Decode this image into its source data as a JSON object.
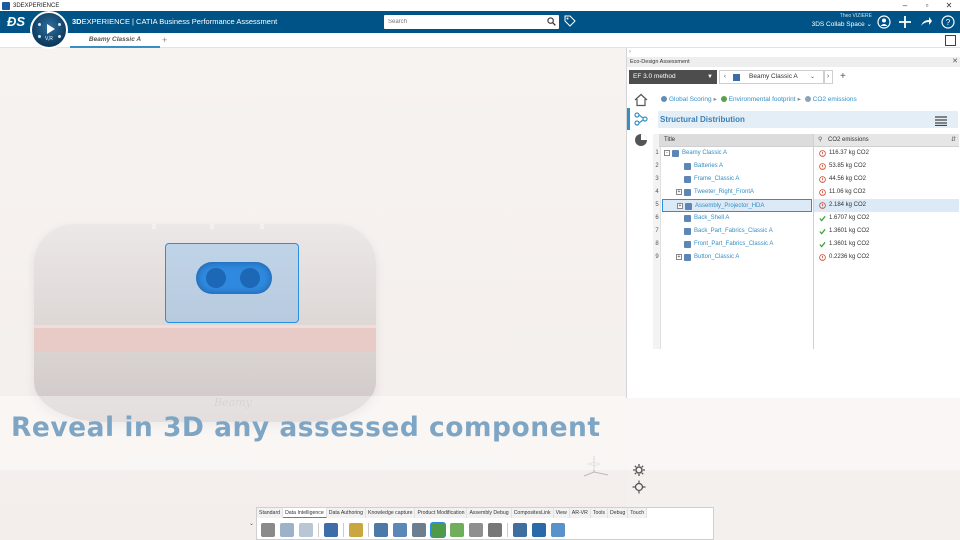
{
  "window": {
    "title": "3DEXPERIENCE"
  },
  "header": {
    "brand_bold": "3D",
    "brand_rest": "EXPERIENCE | CATIA Business Performance Assessment",
    "compass_label": "V,R",
    "search": {
      "placeholder": "Search"
    },
    "user": {
      "name": "Theo VIZIERE",
      "collab_space": "3DS Collab Space"
    }
  },
  "tabs": {
    "active": "Beamy Classic A",
    "add": "+"
  },
  "viewport": {
    "headline": "Reveal in 3D any assessed component",
    "product_logo": "Beamy"
  },
  "panel": {
    "title": "Eco-Design Assessment",
    "method": "EF 3.0 method",
    "current_product": "Beamy Classic A",
    "breadcrumb": [
      "Global Scoring",
      "Environmental footprint",
      "CO2 emissions"
    ],
    "section_title": "Structural Distribution",
    "columns": {
      "title": "Title",
      "value": "CO2 emissions"
    },
    "rows": [
      {
        "num": "1",
        "name": "Beamy Classic A",
        "value": "116.37 kg CO2",
        "status": "warn",
        "depth": 0,
        "toggle": "-"
      },
      {
        "num": "2",
        "name": "Batteries A",
        "value": "53.85 kg CO2",
        "status": "warn",
        "depth": 1,
        "toggle": ""
      },
      {
        "num": "3",
        "name": "Frame_Classic A",
        "value": "44.56 kg CO2",
        "status": "warn",
        "depth": 1,
        "toggle": ""
      },
      {
        "num": "4",
        "name": "Tweeter_Right_FrontA",
        "value": "11.06 kg CO2",
        "status": "warn",
        "depth": 1,
        "toggle": "+"
      },
      {
        "num": "5",
        "name": "Assembly_Projector_HDA",
        "value": "2.184 kg CO2",
        "status": "warn",
        "depth": 1,
        "toggle": "+",
        "selected": true
      },
      {
        "num": "6",
        "name": "Back_Shell A",
        "value": "1.6707 kg CO2",
        "status": "ok",
        "depth": 1,
        "toggle": ""
      },
      {
        "num": "7",
        "name": "Back_Part_Fabrics_Classic A",
        "value": "1.3601 kg CO2",
        "status": "ok",
        "depth": 1,
        "toggle": ""
      },
      {
        "num": "8",
        "name": "Front_Part_Fabrics_Classic A",
        "value": "1.3601 kg CO2",
        "status": "ok",
        "depth": 1,
        "toggle": ""
      },
      {
        "num": "9",
        "name": "Button_Classic A",
        "value": "0.2236 kg CO2",
        "status": "warn",
        "depth": 1,
        "toggle": "+"
      }
    ]
  },
  "action_bar": {
    "tabs": [
      "Standard",
      "Data Intelligence",
      "Data Authoring",
      "Knowledge capture",
      "Product Modification",
      "Assembly Debug",
      "CompositesLink",
      "View",
      "AR-VR",
      "Tools",
      "Debug",
      "Touch"
    ],
    "active_tab": "Data Intelligence"
  },
  "colors": {
    "brand_blue": "#005386",
    "accent": "#368ec4",
    "warn": "#d0482c",
    "ok": "#3aa336",
    "highlight": "#2b8fe0"
  }
}
